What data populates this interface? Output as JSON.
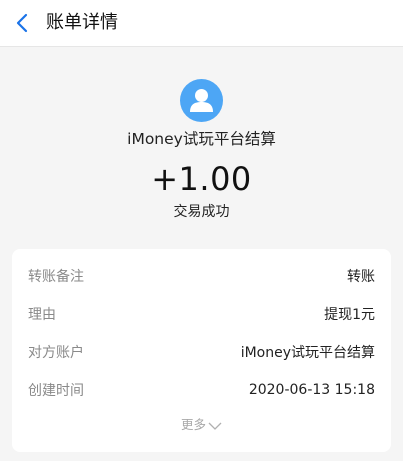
{
  "header": {
    "title": "账单详情",
    "back_icon": "chevron-left-icon"
  },
  "summary": {
    "avatar_icon": "user-avatar-icon",
    "counterparty": "iMoney试玩平台结算",
    "amount": "+1.00",
    "status": "交易成功"
  },
  "details": {
    "rows": [
      {
        "label": "转账备注",
        "value": "转账"
      },
      {
        "label": "理由",
        "value": "提现1元"
      },
      {
        "label": "对方账户",
        "value": "iMoney试玩平台结算"
      },
      {
        "label": "创建时间",
        "value": "2020-06-13 15:18"
      }
    ],
    "more_label": "更多",
    "more_icon": "chevron-down-icon"
  },
  "colors": {
    "accent": "#1a73e8",
    "avatar_bg": "#4da6f5",
    "page_bg": "#f5f5f5"
  }
}
